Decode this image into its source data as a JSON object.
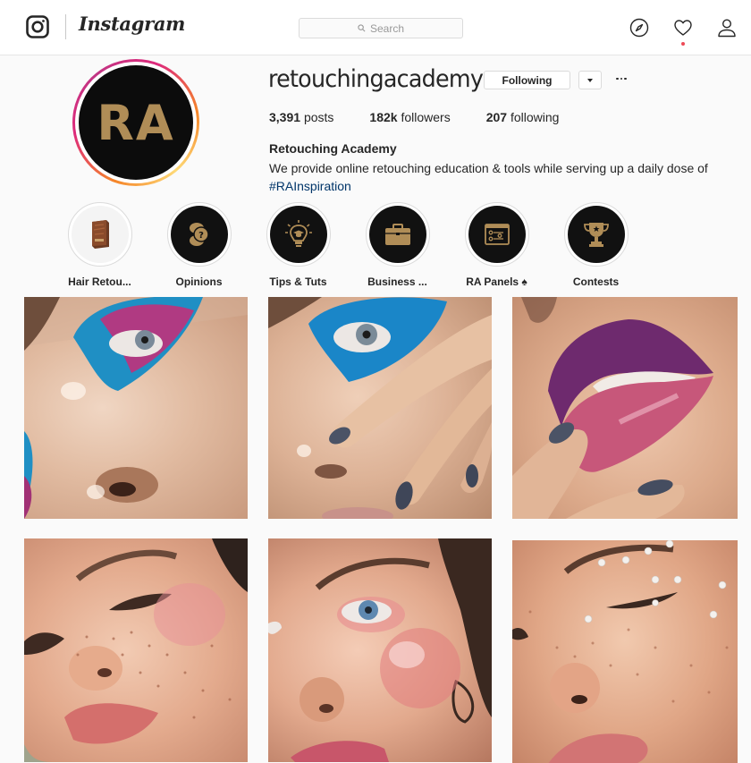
{
  "header": {
    "brand": "Instagram",
    "search_placeholder": "Search",
    "notification_dot_color": "#ed4956"
  },
  "profile": {
    "username": "retouchingacademy",
    "avatar_initials": "RA",
    "avatar_text_color": "#b08d57",
    "following_button": "Following",
    "stats": {
      "posts_count": "3,391",
      "posts_label": "posts",
      "followers_count": "182k",
      "followers_label": "followers",
      "following_count": "207",
      "following_label": "following"
    },
    "display_name": "Retouching Academy",
    "bio": "We provide online retouching education & tools while serving up a daily dose of",
    "hashtag": "#RAInspiration",
    "hashtag_color": "#003569"
  },
  "highlights": [
    {
      "label": "Hair Retou...",
      "icon": "product-box-icon"
    },
    {
      "label": "Opinions",
      "icon": "speech-bubbles-question-icon"
    },
    {
      "label": "Tips & Tuts",
      "icon": "lightbulb-graduation-icon"
    },
    {
      "label": "Business ...",
      "icon": "briefcase-icon"
    },
    {
      "label": "RA Panels ♠",
      "icon": "panel-window-icon"
    },
    {
      "label": "Contests",
      "icon": "trophy-icon"
    }
  ],
  "posts": [
    {
      "description": "Close-up of eye with blue and magenta painted eyeshadow"
    },
    {
      "description": "Face with blue eyeshadow and hand with glitter nails"
    },
    {
      "description": "Lips with purple and pink metallic lipstick, glitter nail"
    },
    {
      "description": "Freckled face with pink blush, eyes closed"
    },
    {
      "description": "Face with blue eye and pink blush, curly hair"
    },
    {
      "description": "Freckled face with pearl decorations near closed eye"
    }
  ]
}
